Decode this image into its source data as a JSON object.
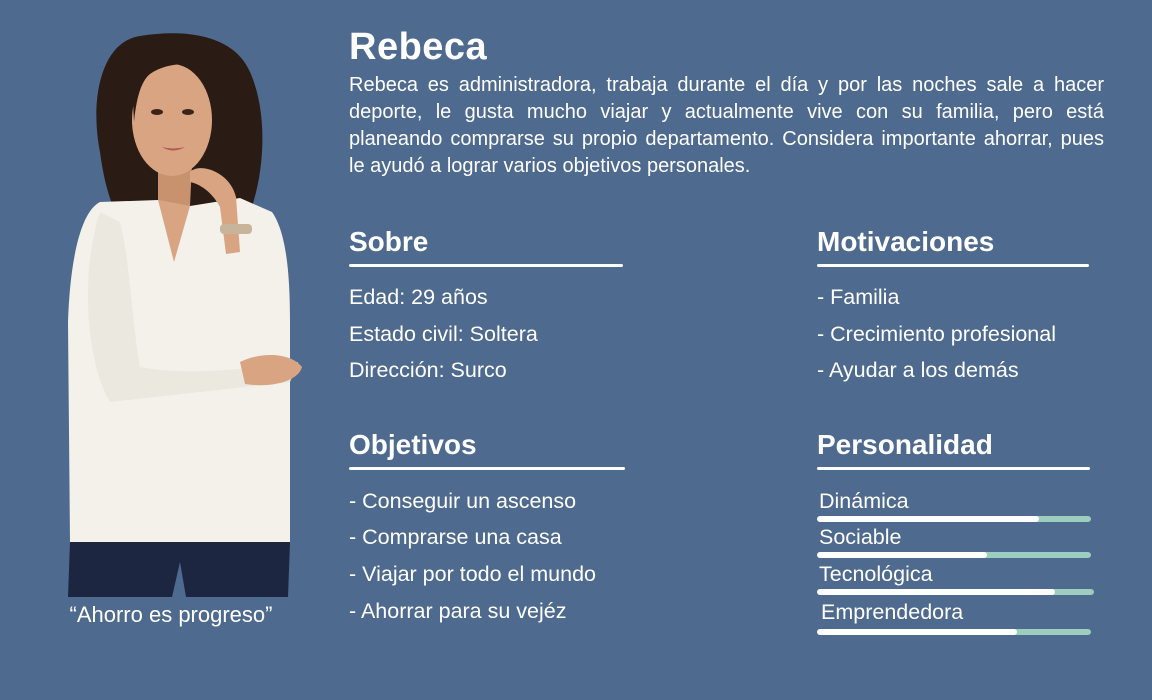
{
  "persona": {
    "name": "Rebeca",
    "description": "Rebeca es administradora, trabaja durante el día y por las noches sale a hacer deporte, le gusta mucho viajar y actualmente vive con su familia, pero está planeando comprarse su propio departamento. Considera importante ahorrar, pues le ayudó a lograr varios objetivos personales.",
    "quote": "“Ahorro es progreso”",
    "photo_icon": "woman-portrait-photo"
  },
  "sobre": {
    "title": "Sobre",
    "items": [
      "Edad: 29 años",
      "Estado civil: Soltera",
      "Dirección: Surco"
    ]
  },
  "motivaciones": {
    "title": "Motivaciones",
    "items": [
      "- Familia",
      "- Crecimiento profesional",
      "- Ayudar a los demás"
    ]
  },
  "objetivos": {
    "title": "Objetivos",
    "items": [
      "- Conseguir un ascenso",
      "- Comprarse una casa",
      "- Viajar por todo el mundo",
      "- Ahorrar para su vejéz"
    ]
  },
  "personalidad": {
    "title": "Personalidad",
    "traits": [
      {
        "label": "Dinámica",
        "level": 0.81
      },
      {
        "label": "Sociable",
        "level": 0.62
      },
      {
        "label": "Tecnológica",
        "level": 0.86
      },
      {
        "label": "Emprendedora",
        "level": 0.73
      }
    ]
  },
  "colors": {
    "background": "#4e6a8e",
    "text": "#ffffff",
    "bar_track": "#9ccdbf",
    "bar_fill": "#ffffff"
  }
}
